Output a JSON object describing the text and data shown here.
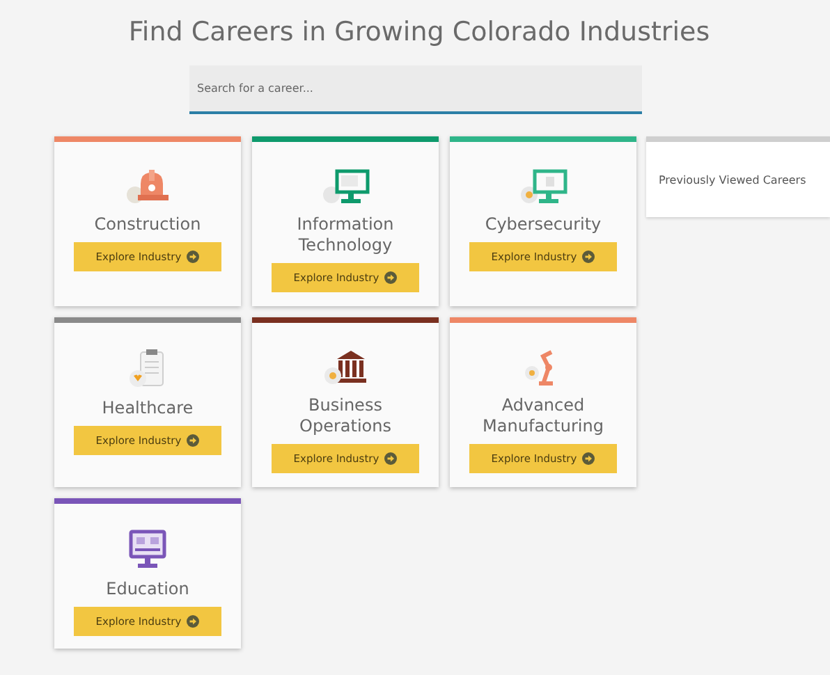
{
  "title": "Find Careers in Growing Colorado Industries",
  "search": {
    "placeholder": "Search for a career..."
  },
  "industries": [
    {
      "name": "Construction",
      "kind": "hardhat",
      "color": "#ee8766",
      "button": "Explore Industry"
    },
    {
      "name": "Information Technology",
      "kind": "monitor",
      "color": "#0e9a6c",
      "button": "Explore Industry"
    },
    {
      "name": "Cybersecurity",
      "kind": "secure-monitor",
      "color": "#2fb589",
      "button": "Explore Industry"
    },
    {
      "name": "Healthcare",
      "kind": "clipboard",
      "color": "#8a8a8a",
      "button": "Explore Industry"
    },
    {
      "name": "Business Operations",
      "kind": "bank",
      "color": "#7a3020",
      "button": "Explore Industry"
    },
    {
      "name": "Advanced Manufacturing",
      "kind": "robot-arm",
      "color": "#ee8766",
      "button": "Explore Industry"
    },
    {
      "name": "Education",
      "kind": "computer",
      "color": "#7a55b8",
      "button": "Explore Industry"
    }
  ],
  "side_panel": {
    "title": "Previously Viewed Careers"
  }
}
